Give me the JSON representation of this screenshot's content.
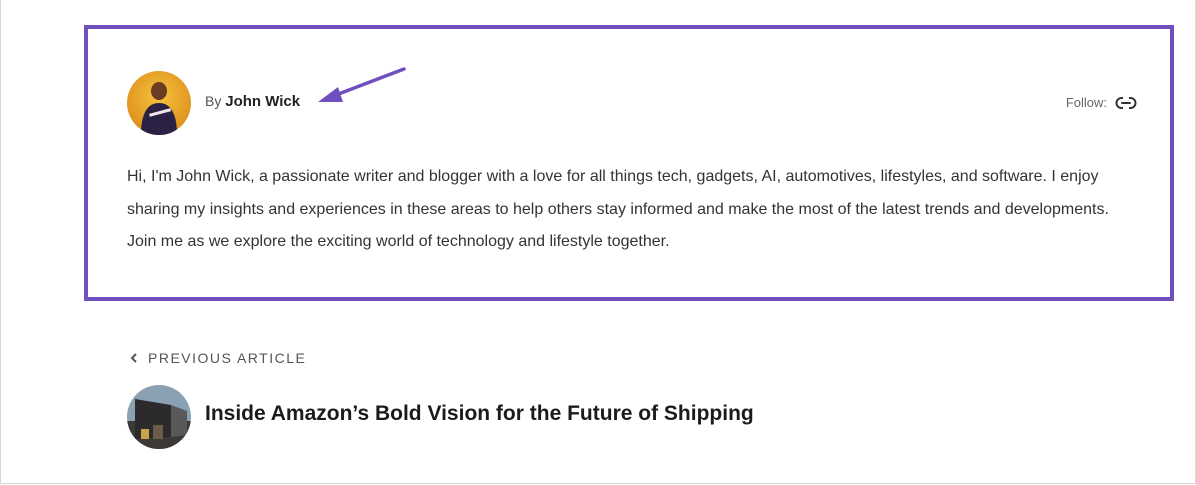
{
  "author": {
    "by_label": "By",
    "name": "John Wick",
    "follow_label": "Follow:",
    "link_icon": "link-icon",
    "bio": "Hi, I'm John Wick, a passionate writer and blogger with a love for all things tech, gadgets, AI, automotives, lifestyles, and software. I enjoy sharing my insights and experiences in these areas to help others stay informed and make the most of the latest trends and developments. Join me as we explore the exciting world of technology and lifestyle together."
  },
  "previous_article": {
    "label": "PREVIOUS ARTICLE",
    "chevron_icon": "chevron-left-icon",
    "title": "Inside Amazon’s Bold Vision for the Future of Shipping"
  },
  "colors": {
    "highlight_border": "#7050bf",
    "arrow": "#7050bf"
  }
}
